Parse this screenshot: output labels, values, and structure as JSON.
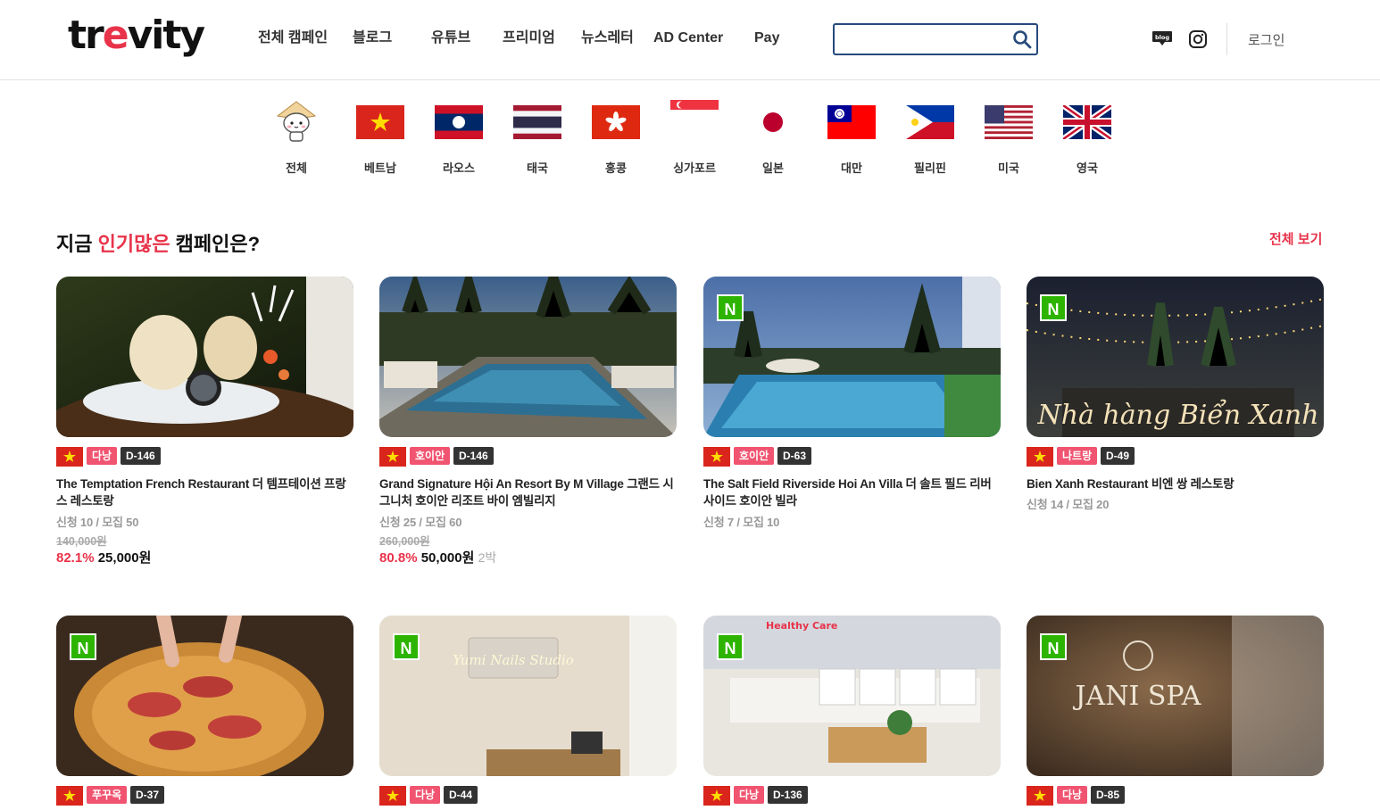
{
  "header": {
    "logo": {
      "pre": "tr",
      "accent": "e",
      "post": "vity"
    },
    "nav": [
      "전체 캠페인",
      "블로그",
      "유튜브",
      "프리미엄",
      "뉴스레터",
      "AD Center",
      "Pay"
    ],
    "search": {
      "placeholder": "",
      "value": ""
    },
    "blog_icon_text": "blog",
    "login": "로그인"
  },
  "countries": [
    "전체",
    "베트남",
    "라오스",
    "태국",
    "홍콩",
    "싱가포르",
    "일본",
    "대만",
    "필리핀",
    "미국",
    "영국"
  ],
  "section": {
    "title_pre": "지금 ",
    "title_highlight": "인기많은",
    "title_post": " 캠페인은?",
    "view_all": "전체 보기"
  },
  "cards": [
    {
      "region": "다낭",
      "dday": "D-146",
      "title": "The Temptation French Restaurant 더 템프테이션 프랑스 레스토랑",
      "stats": "신청 10 / 모집 50",
      "orig": "140,000원",
      "pct": "82.1%",
      "price": "25,000원",
      "unit": "",
      "n": false
    },
    {
      "region": "호이안",
      "dday": "D-146",
      "title": "Grand Signature Hội An Resort By M Village 그랜드 시그니처 호이안 리조트 바이 엠빌리지",
      "stats": "신청 25 / 모집 60",
      "orig": "260,000원",
      "pct": "80.8%",
      "price": "50,000원",
      "unit": "2박",
      "n": false
    },
    {
      "region": "호이안",
      "dday": "D-63",
      "title": "The Salt Field Riverside Hoi An Villa 더 솔트 필드 리버사이드 호이안 빌라",
      "stats": "신청 7 / 모집 10",
      "orig": "",
      "pct": "",
      "price": "",
      "unit": "",
      "n": true
    },
    {
      "region": "나트랑",
      "dday": "D-49",
      "title": "Bien Xanh Restaurant 비엔 쌍 레스토랑",
      "stats": "신청 14 / 모집 20",
      "orig": "",
      "pct": "",
      "price": "",
      "unit": "",
      "n": true
    },
    {
      "region": "푸꾸옥",
      "dday": "D-37",
      "n": true
    },
    {
      "region": "다낭",
      "dday": "D-44",
      "n": true
    },
    {
      "region": "다낭",
      "dday": "D-136",
      "n": true
    },
    {
      "region": "다낭",
      "dday": "D-85",
      "n": true
    }
  ],
  "n_badge": "N",
  "thumb_texts": {
    "card4_sign": "Nhà hàng Biển Xanh",
    "card6_sign": "Yumi Nails Studio",
    "card7_sign": "Healthy Care",
    "card8_sign": "JANI SPA"
  }
}
